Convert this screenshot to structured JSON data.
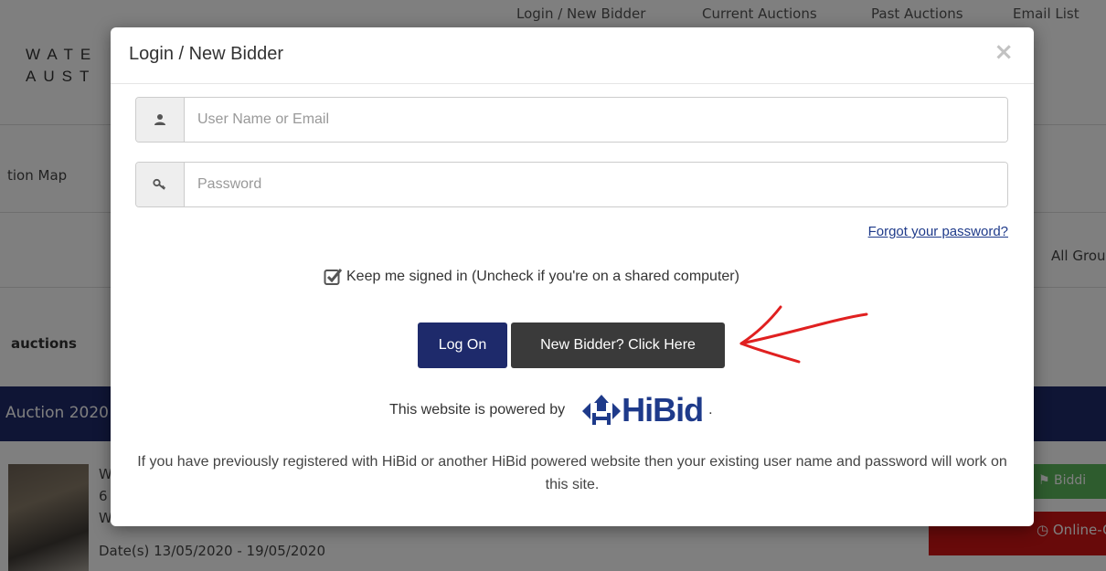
{
  "background": {
    "nav": [
      "Login / New Bidder",
      "Current Auctions",
      "Past Auctions",
      "Email List"
    ],
    "logo_line1": "WATE",
    "logo_line2": "AUST",
    "auction_map": "tion Map",
    "all_groups": "All Grou",
    "auctions_heading": "auctions",
    "auction_bar": "Auction 2020",
    "item_line1": "W",
    "item_line2": "6",
    "item_line3": "W",
    "dates": "Date(s) 13/05/2020 - 19/05/2020",
    "bidding_label": "Biddi",
    "online_label": "Online-O"
  },
  "modal": {
    "title": "Login / New Bidder",
    "close": "×",
    "username_placeholder": "User Name or Email",
    "password_placeholder": "Password",
    "forgot_link": "Forgot your password?",
    "keep_signed_in": "Keep me signed in (Uncheck if you're on a shared computer)",
    "logon_button": "Log On",
    "new_bidder_button": "New Bidder? Click Here",
    "powered_by": "This website is powered by",
    "brand": "HiBid",
    "brand_suffix": ".",
    "info_text": "If you have previously registered with HiBid or another HiBid powered website then your existing user name and password will work on this site."
  },
  "colors": {
    "navy": "#1e2a6b",
    "dark_button": "#3a3a3a",
    "link": "#1e3a8a",
    "arrow": "#e02020",
    "green": "#5cb85c",
    "red": "#d01515"
  },
  "icons": [
    "user-icon",
    "key-icon",
    "checkbox-checked-icon",
    "hibid-logo-icon",
    "flag-icon",
    "clock-icon",
    "red-arrow-annotation"
  ]
}
